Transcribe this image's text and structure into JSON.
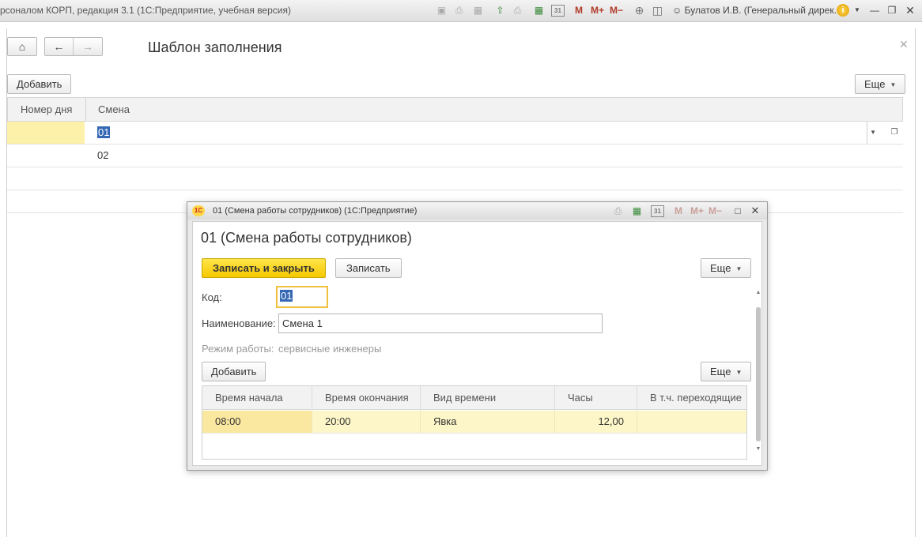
{
  "titlebar": {
    "app_title": "рсоналом КОРП, редакция 3.1  (1С:Предприятие, учебная версия)",
    "icons": [
      "save-icon",
      "print-icon",
      "preview-icon",
      "upload-icon",
      "printer-icon",
      "calculator-icon",
      "calendar-icon",
      "zoom-icon",
      "panel-icon"
    ],
    "calendar_day": "31",
    "memory_m": "M",
    "memory_m_plus": "M+",
    "memory_m_minus": "M−",
    "user": "Булатов И.В. (Генеральный дирек...",
    "info_glyph": "i"
  },
  "main_form": {
    "title": "Шаблон заполнения",
    "add_button": "Добавить",
    "more_button": "Еще",
    "columns": [
      "Номер дня",
      "Смена"
    ],
    "rows": [
      {
        "day": "",
        "shift": "01"
      },
      {
        "day": "",
        "shift": "02"
      },
      {
        "day": "",
        "shift": ""
      },
      {
        "day": "",
        "shift": ""
      }
    ]
  },
  "dialog": {
    "window_title": "01 (Смена работы сотрудников)  (1С:Предприятие)",
    "logo_text": "1С",
    "heading": "01 (Смена работы сотрудников)",
    "save_close_button": "Записать и закрыть",
    "save_button": "Записать",
    "more_button": "Еще",
    "code_label": "Код:",
    "code_value": "01",
    "name_label": "Наименование:",
    "name_value": "Смена 1",
    "mode_label": "Режим работы:",
    "mode_value": "сервисные инженеры",
    "add_button": "Добавить",
    "more_button2": "Еще",
    "columns": [
      "Время начала",
      "Время окончания",
      "Вид времени",
      "Часы",
      "В т.ч. переходящие"
    ],
    "rows": [
      {
        "start": "08:00",
        "end": "20:00",
        "kind": "Явка",
        "hours": "12,00",
        "carry": ""
      }
    ],
    "memory_m": "M",
    "memory_m_plus": "M+",
    "memory_m_minus": "M−",
    "calendar_day": "31"
  }
}
